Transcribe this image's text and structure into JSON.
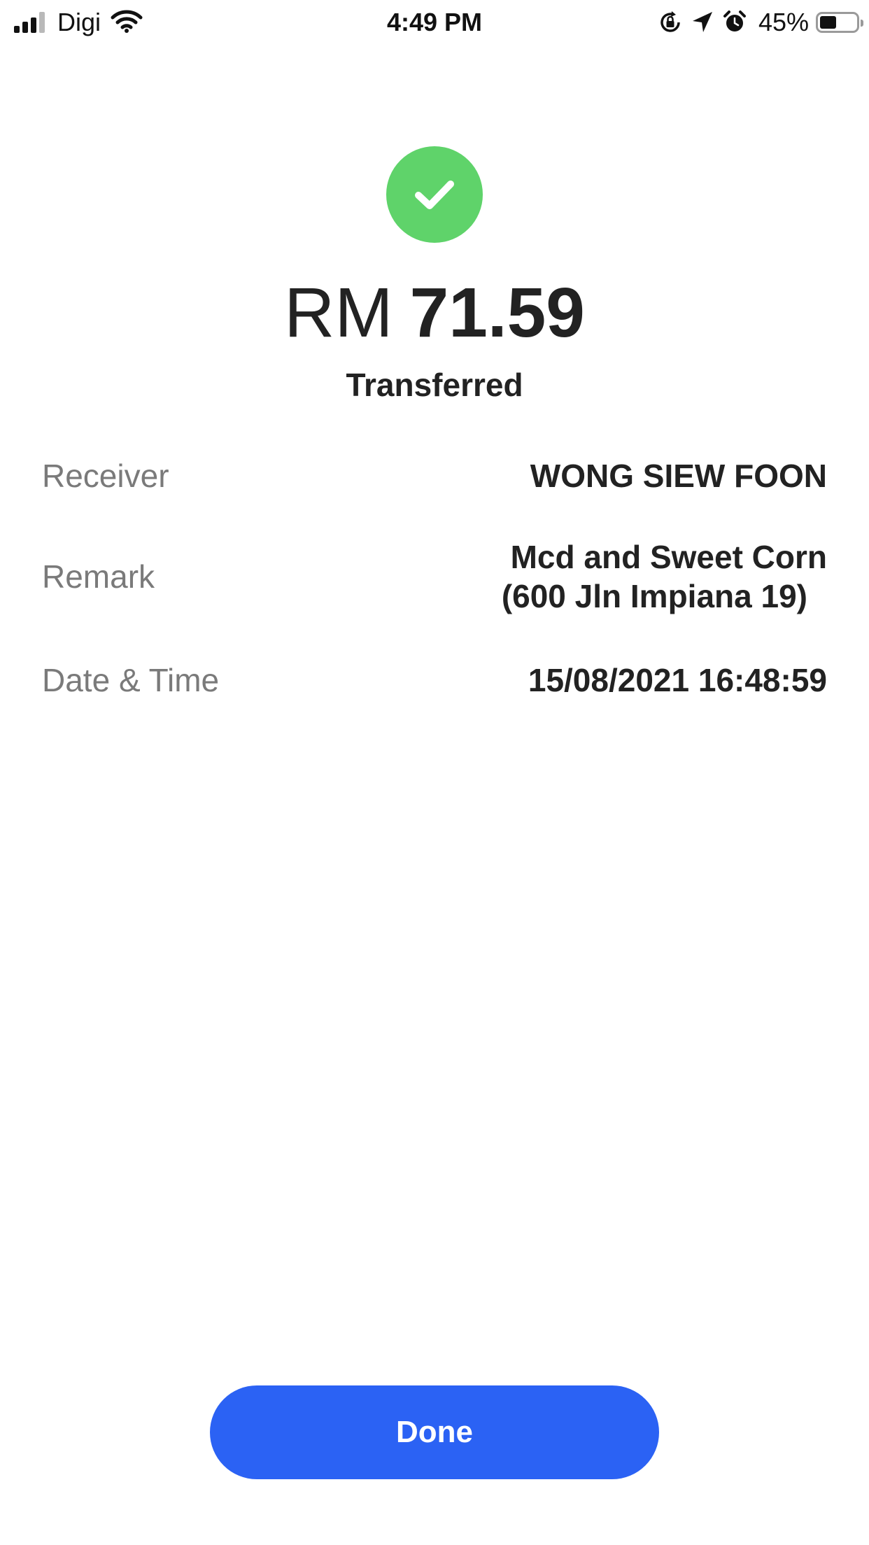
{
  "status_bar": {
    "carrier": "Digi",
    "time": "4:49 PM",
    "battery_percent": "45%",
    "battery_level": 0.45,
    "icons": [
      "signal-icon",
      "wifi-icon",
      "orientation-lock-icon",
      "location-arrow-icon",
      "alarm-icon",
      "battery-icon"
    ]
  },
  "receipt": {
    "status_icon": "checkmark-icon",
    "status_color": "#5fd36a",
    "currency": "RM",
    "amount": "71.59",
    "status_label": "Transferred",
    "details": {
      "receiver": {
        "label": "Receiver",
        "value": "WONG SIEW FOON"
      },
      "remark": {
        "label": "Remark",
        "value_line1": "Mcd and Sweet Corn",
        "value_line2": "(600 Jln Impiana 19)"
      },
      "datetime": {
        "label": "Date & Time",
        "value": "15/08/2021 16:48:59"
      }
    }
  },
  "actions": {
    "done_label": "Done",
    "done_color": "#2b62f4"
  }
}
